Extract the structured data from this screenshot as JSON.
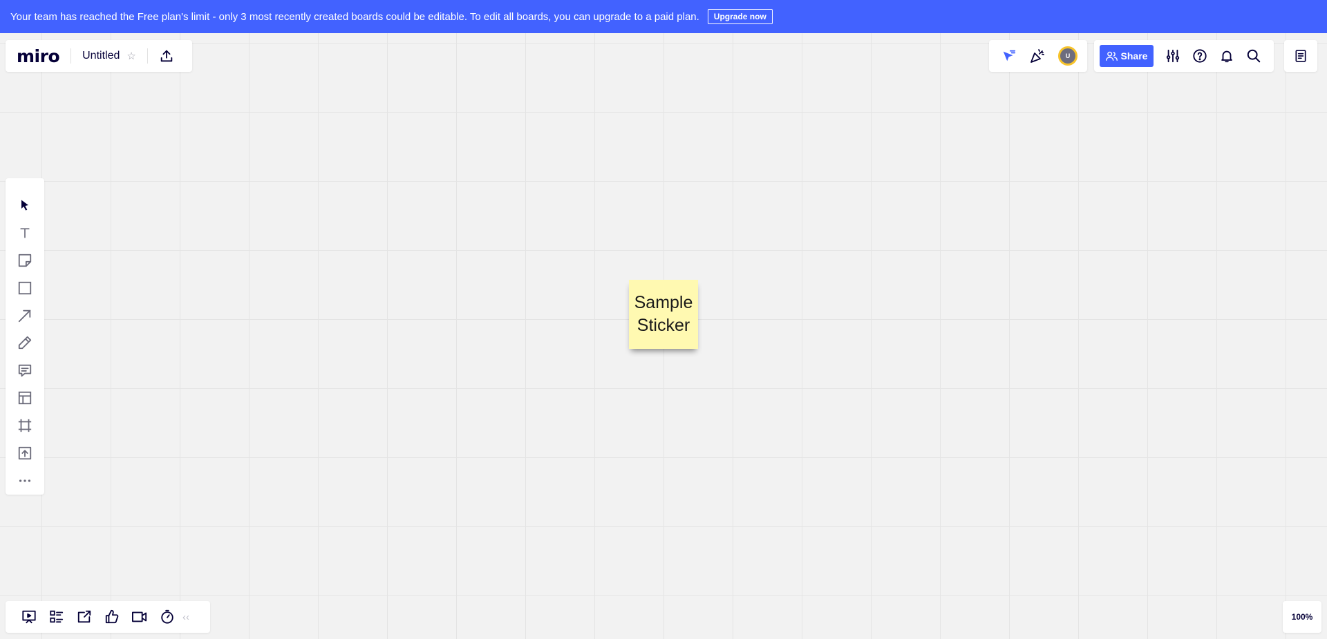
{
  "banner": {
    "message": "Your team has reached the Free plan's limit - only 3 most recently created boards could be editable. To edit all boards, you can upgrade to a paid plan.",
    "upgrade_label": "Upgrade now"
  },
  "board": {
    "logo": "miro",
    "title": "Untitled"
  },
  "collab": {
    "avatar_initial": "U"
  },
  "toolbar": {
    "share_label": "Share"
  },
  "left_tools": [
    "select-icon",
    "text-icon",
    "sticky-note-icon",
    "shape-icon",
    "arrow-icon",
    "pen-icon",
    "comment-icon",
    "template-icon",
    "frame-icon",
    "upload-icon",
    "more-icon"
  ],
  "sticker": {
    "text": "Sample Sticker",
    "color": "#fff9b1"
  },
  "bottom_tools": [
    "present-icon",
    "kanban-icon",
    "share-screen-icon",
    "vote-icon",
    "video-icon",
    "timer-icon"
  ],
  "zoom": {
    "level": "100%"
  },
  "colors": {
    "accent": "#4262ff",
    "ink": "#050038",
    "icon": "#6b6b7a",
    "canvas": "#f2f2f2"
  }
}
